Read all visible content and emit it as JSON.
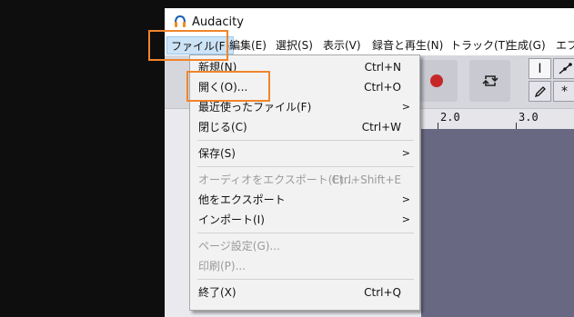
{
  "app": {
    "title": "Audacity"
  },
  "menubar": [
    "ファイル(F)",
    "編集(E)",
    "選択(S)",
    "表示(V)",
    "録音と再生(N)",
    "トラック(T)",
    "生成(G)",
    "エフ"
  ],
  "ruler": {
    "labels": [
      "2.0",
      "3.0"
    ]
  },
  "file_menu": {
    "new": {
      "label": "新規(N)",
      "shortcut": "Ctrl+N"
    },
    "open": {
      "label": "開く(O)...",
      "shortcut": "Ctrl+O"
    },
    "recent": {
      "label": "最近使ったファイル(F)"
    },
    "close": {
      "label": "閉じる(C)",
      "shortcut": "Ctrl+W"
    },
    "save": {
      "label": "保存(S)"
    },
    "export_audio": {
      "label": "オーディオをエクスポート(E)...",
      "shortcut": "Ctrl+Shift+E"
    },
    "export_other": {
      "label": "他をエクスポート"
    },
    "import": {
      "label": "インポート(I)"
    },
    "page_setup": {
      "label": "ページ設定(G)..."
    },
    "print": {
      "label": "印刷(P)..."
    },
    "exit": {
      "label": "終了(X)",
      "shortcut": "Ctrl+Q"
    },
    "submenu_arrow": ">"
  },
  "tools": {
    "select_cursor": "I",
    "multi": "*"
  },
  "colors": {
    "highlight": "#f0852c",
    "record": "#c62828",
    "track_bg": "#686883"
  }
}
